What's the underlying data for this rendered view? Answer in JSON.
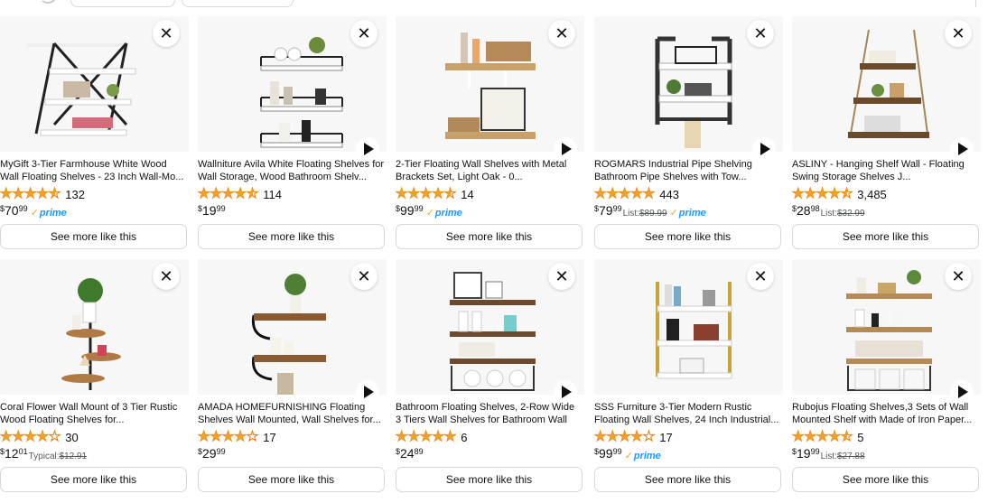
{
  "top_chips": [
    "",
    ""
  ],
  "products": [
    {
      "title": "MyGift 3-Tier Farmhouse White Wood Wall Floating Shelves - 23 Inch Wall-Mo...",
      "rating": 4.5,
      "reviews": "132",
      "currency": "$",
      "whole": "70",
      "fraction": "99",
      "list_label": "",
      "list_price": "",
      "prime": true,
      "prime_label": "prime",
      "has_video": false,
      "close_icon": "close-icon",
      "button": "See more like this"
    },
    {
      "title": "Wallniture Avila White Floating Shelves for Wall Storage, Wood Bathroom Shelv...",
      "rating": 4.5,
      "reviews": "114",
      "currency": "$",
      "whole": "19",
      "fraction": "99",
      "list_label": "",
      "list_price": "",
      "prime": false,
      "prime_label": "",
      "has_video": true,
      "close_icon": "close-icon",
      "button": "See more like this"
    },
    {
      "title": "2-Tier Floating Wall Shelves with Metal Brackets Set, Light Oak - 0...",
      "rating": 4.5,
      "reviews": "14",
      "currency": "$",
      "whole": "99",
      "fraction": "99",
      "list_label": "",
      "list_price": "",
      "prime": true,
      "prime_label": "prime",
      "has_video": true,
      "close_icon": "close-icon",
      "button": "See more like this"
    },
    {
      "title": "ROGMARS Industrial Pipe Shelving Bathroom Pipe Shelves with Tow...",
      "rating": 5,
      "reviews": "443",
      "currency": "$",
      "whole": "79",
      "fraction": "99",
      "list_label": "List:",
      "list_price": "$89.99",
      "prime": true,
      "prime_label": "prime",
      "has_video": true,
      "close_icon": "close-icon",
      "button": "See more like this"
    },
    {
      "title": "ASLINY - Hanging Shelf Wall - Floating Swing Storage Shelves J...",
      "rating": 4.5,
      "reviews": "3,485",
      "currency": "$",
      "whole": "28",
      "fraction": "98",
      "list_label": "List:",
      "list_price": "$32.99",
      "prime": false,
      "prime_label": "",
      "has_video": true,
      "close_icon": "close-icon",
      "button": "See more like this"
    },
    {
      "title": "Coral Flower Wall Mount of 3 Tier Rustic Wood Floating Shelves for...",
      "rating": 4,
      "reviews": "30",
      "currency": "$",
      "whole": "12",
      "fraction": "01",
      "list_label": "Typical:",
      "list_price": "$12.91",
      "prime": false,
      "prime_label": "",
      "has_video": false,
      "close_icon": "close-icon",
      "button": "See more like this"
    },
    {
      "title": "AMADA HOMEFURNISHING Floating Shelves Wall Mounted, Wall Shelves for...",
      "rating": 4,
      "reviews": "17",
      "currency": "$",
      "whole": "29",
      "fraction": "99",
      "list_label": "",
      "list_price": "",
      "prime": false,
      "prime_label": "",
      "has_video": true,
      "close_icon": "close-icon",
      "button": "See more like this"
    },
    {
      "title": "Bathroom Floating Shelves, 2-Row Wide 3 Tiers Wall Shelves for Bathroom Wall He...",
      "rating": 5,
      "reviews": "6",
      "currency": "$",
      "whole": "24",
      "fraction": "89",
      "list_label": "",
      "list_price": "",
      "prime": false,
      "prime_label": "",
      "has_video": true,
      "close_icon": "close-icon",
      "button": "See more like this"
    },
    {
      "title": "SSS Furniture 3-Tier Modern Rustic Floating Wall Shelves, 24 Inch Industrial...",
      "rating": 4,
      "reviews": "17",
      "currency": "$",
      "whole": "99",
      "fraction": "99",
      "list_label": "",
      "list_price": "",
      "prime": true,
      "prime_label": "prime",
      "has_video": false,
      "close_icon": "close-icon",
      "button": "See more like this"
    },
    {
      "title": "Rubojus Floating Shelves,3 Sets of Wall Mounted Shelf with Made of Iron Paper...",
      "rating": 4.5,
      "reviews": "5",
      "currency": "$",
      "whole": "19",
      "fraction": "99",
      "list_label": "List:",
      "list_price": "$27.88",
      "prime": false,
      "prime_label": "",
      "has_video": true,
      "close_icon": "close-icon",
      "button": "See more like this"
    }
  ],
  "colors": {
    "star": "#f0a12b",
    "prime": "#1a98ff",
    "prime_check": "#f2a32a",
    "border": "#d5d9d9",
    "image_bg": "#f7f7f7"
  }
}
